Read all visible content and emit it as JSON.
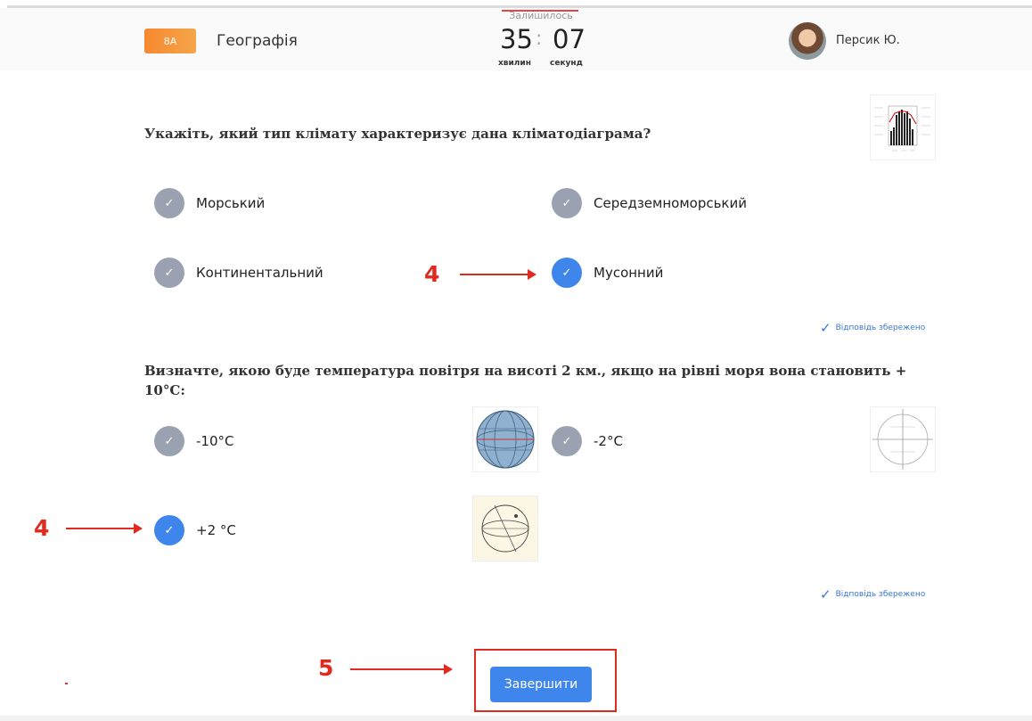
{
  "header": {
    "class_badge": "8А",
    "subject": "Географія",
    "user_name": "Персик Ю."
  },
  "timer": {
    "label": "Залишилось",
    "minutes": "35",
    "separator": ":",
    "seconds": "07",
    "minutes_unit": "хвилин",
    "seconds_unit": "секунд"
  },
  "questions": [
    {
      "text": "Укажіть, який тип клімату характеризує дана кліматодіаграма?",
      "options": [
        {
          "label": "Морський",
          "selected": false
        },
        {
          "label": "Середземноморський",
          "selected": false
        },
        {
          "label": "Континентальний",
          "selected": false
        },
        {
          "label": "Мусонний",
          "selected": true
        }
      ],
      "status": "Відповідь збережено"
    },
    {
      "text": "Визначте, якою буде температура повітря на висоті 2 км., якщо на рівні моря вона становить + 10°С:",
      "options": [
        {
          "label": "-10°C",
          "selected": false
        },
        {
          "label": "-2°C",
          "selected": false
        },
        {
          "label": "+2 °C",
          "selected": true
        }
      ],
      "status": "Відповідь збережено"
    }
  ],
  "annotations": {
    "step_4a": "4",
    "step_4b": "4",
    "step_5": "5"
  },
  "finish_button": "Завершити",
  "icons": {
    "check": "check-icon",
    "saved": "check-icon"
  },
  "colors": {
    "accent": "#3f86ec",
    "badge": "#f6892f",
    "annotation": "#e02a20",
    "unselected": "#9aa2b1"
  }
}
